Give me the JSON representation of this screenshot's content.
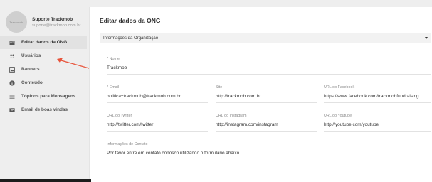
{
  "user": {
    "avatar_text": "Trackmob",
    "name": "Suporte Trackmob",
    "email": "suporte@trackmob.com.br"
  },
  "sidebar": {
    "items": [
      {
        "label": "Editar dados da ONG",
        "icon": "id-card-icon"
      },
      {
        "label": "Usuários",
        "icon": "people-icon"
      },
      {
        "label": "Banners",
        "icon": "image-icon"
      },
      {
        "label": "Conteúdo",
        "icon": "info-icon"
      },
      {
        "label": "Tópicos para Mensagens",
        "icon": "list-icon"
      },
      {
        "label": "Email de boas vindas",
        "icon": "mail-icon"
      }
    ],
    "active_index": 0
  },
  "main": {
    "title": "Editar dados da ONG",
    "section": "Informações da Organização",
    "fields": {
      "nome": {
        "label": "* Nome",
        "value": "Trackmob"
      },
      "email": {
        "label": "* Email",
        "value": "politica+trackmob@trackmob.com.br"
      },
      "site": {
        "label": "Site",
        "value": "http://trackmob.com.br"
      },
      "facebook": {
        "label": "URL do Facebook",
        "value": "https://www.facebook.com/trackmobfundraising"
      },
      "twitter": {
        "label": "URL do Twitter",
        "value": "http://twitter.com/twitter"
      },
      "instagram": {
        "label": "URL do Instagram",
        "value": "http://instagram.com/instagram"
      },
      "youtube": {
        "label": "URL do Youtube",
        "value": "http://youtube.com/youtube"
      },
      "contato": {
        "label": "Informações de Contato",
        "value": "Por favor entre em contato conosco utilizando o formulário abaixo"
      }
    }
  },
  "colors": {
    "arrow": "#e8533a",
    "sidebar_bg": "#eeeeee",
    "active_bg": "#e2e2e2"
  }
}
